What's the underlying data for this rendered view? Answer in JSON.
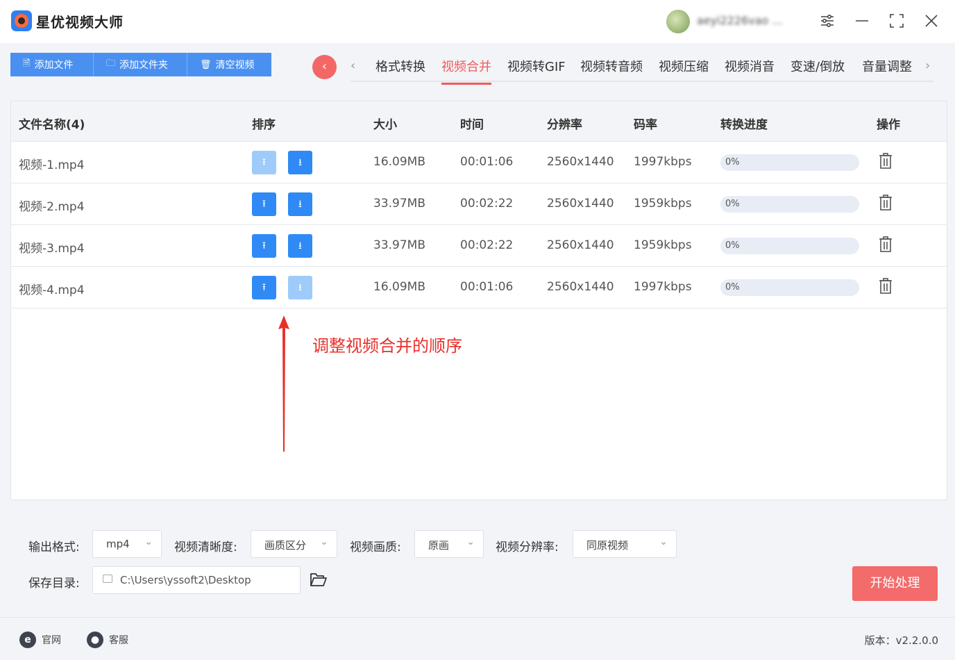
{
  "app": {
    "title": "星优视频大师",
    "username": "aeyi2226vao ..."
  },
  "toolbar": {
    "add_file": "添加文件",
    "add_folder": "添加文件夹",
    "clear": "清空视频"
  },
  "tabs": {
    "items": [
      "格式转换",
      "视频合并",
      "视频转GIF",
      "视频转音频",
      "视频压缩",
      "视频消音",
      "变速/倒放",
      "音量调整"
    ],
    "active": "视频合并"
  },
  "table": {
    "headers": [
      "文件名称(4)",
      "排序",
      "大小",
      "时间",
      "分辨率",
      "码率",
      "转换进度",
      "操作"
    ],
    "rows": [
      {
        "name": "视频-1.mp4",
        "size": "16.09MB",
        "time": "00:01:06",
        "resolution": "2560x1440",
        "bitrate": "1997kbps",
        "progress": "0%",
        "up_enabled": false,
        "down_enabled": true
      },
      {
        "name": "视频-2.mp4",
        "size": "33.97MB",
        "time": "00:02:22",
        "resolution": "2560x1440",
        "bitrate": "1959kbps",
        "progress": "0%",
        "up_enabled": true,
        "down_enabled": true
      },
      {
        "name": "视频-3.mp4",
        "size": "33.97MB",
        "time": "00:02:22",
        "resolution": "2560x1440",
        "bitrate": "1959kbps",
        "progress": "0%",
        "up_enabled": true,
        "down_enabled": true
      },
      {
        "name": "视频-4.mp4",
        "size": "16.09MB",
        "time": "00:01:06",
        "resolution": "2560x1440",
        "bitrate": "1997kbps",
        "progress": "0%",
        "up_enabled": true,
        "down_enabled": false
      }
    ]
  },
  "annotation": {
    "text": "调整视频合并的顺序",
    "color": "#e8302a"
  },
  "settings": {
    "format_label": "输出格式:",
    "format_value": "mp4",
    "clarity_label": "视频清晰度:",
    "clarity_value": "画质区分",
    "quality_label": "视频画质:",
    "quality_value": "原画",
    "resolution_label": "视频分辨率:",
    "resolution_value": "同原视频",
    "save_label": "保存目录:",
    "save_path": "C:\\Users\\yssoft2\\Desktop",
    "start": "开始处理"
  },
  "footer": {
    "website": "官网",
    "support": "客服",
    "version": "版本：v2.2.0.0"
  },
  "colors": {
    "accent_blue": "#2f8af5",
    "accent_red": "#f36b6b",
    "active_tab": "#f05a5a"
  }
}
